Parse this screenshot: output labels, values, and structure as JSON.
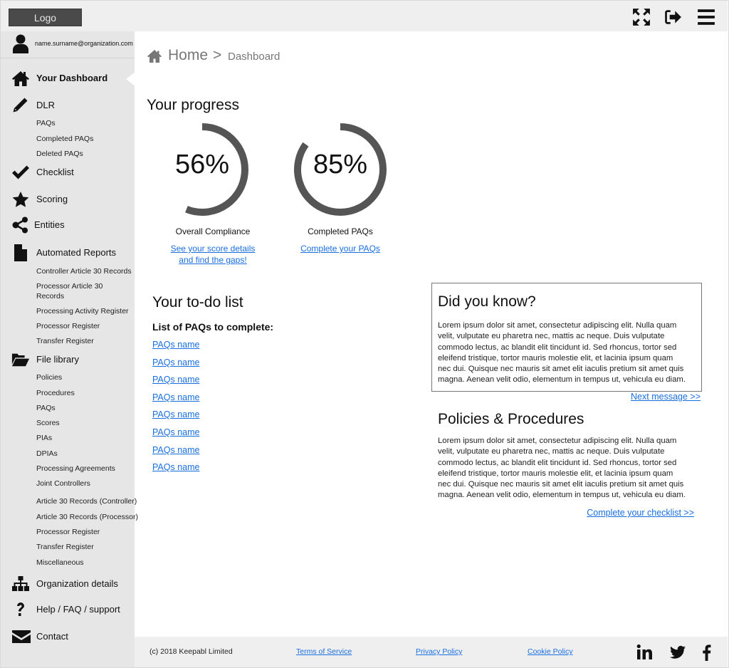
{
  "header": {
    "logo_label": "Logo",
    "icons": [
      "fullscreen-icon",
      "logout-icon",
      "menu-icon"
    ]
  },
  "user": {
    "email": "name.surname@organization.com",
    "icon": "user-icon"
  },
  "sidebar": {
    "items": [
      {
        "label": "Your Dashboard",
        "icon": "home-icon",
        "active": true,
        "children": []
      },
      {
        "label": "DLR",
        "icon": "pencil-icon",
        "children": [
          "PAQs",
          "Completed PAQs",
          "Deleted PAQs"
        ]
      },
      {
        "label": "Checklist",
        "icon": "check-icon",
        "children": []
      },
      {
        "label": "Scoring",
        "icon": "star-icon",
        "children": []
      },
      {
        "label": "Entities",
        "icon": "share-icon",
        "children": []
      },
      {
        "label": "Automated Reports",
        "icon": "file-icon",
        "children": [
          "Controller Article 30 Records",
          "Processor Article 30 Records",
          "Processing Activity Register",
          "Processor Register",
          "Transfer Register"
        ]
      },
      {
        "label": "File library",
        "icon": "folder-open-icon",
        "children": [
          "Policies",
          "Procedures",
          "PAQs",
          "Scores",
          "PIAs",
          "DPIAs",
          "Processing Agreements",
          "Joint Controllers",
          "Article 30 Records (Controller)",
          "Article 30 Records (Processor)",
          "Processor Register",
          "Transfer Register",
          "Miscellaneous"
        ]
      },
      {
        "label": "Organization details",
        "icon": "sitemap-icon",
        "children": []
      },
      {
        "label": "Help / FAQ / support",
        "icon": "question-icon",
        "children": []
      },
      {
        "label": "Contact",
        "icon": "envelope-icon",
        "children": []
      }
    ]
  },
  "breadcrumb": {
    "home": "Home",
    "separator": ">",
    "current": "Dashboard"
  },
  "progress": {
    "title": "Your progress",
    "rings": [
      {
        "value_text": "56%",
        "fraction": 0.56,
        "label": "Overall Compliance",
        "link_line1": "See your score details",
        "link_line2": "and find the gaps!"
      },
      {
        "value_text": "85%",
        "fraction": 0.85,
        "label": "Completed PAQs",
        "link_line1": "Complete your PAQs",
        "link_line2": ""
      }
    ],
    "ring_color": "#555555"
  },
  "todo": {
    "title": "Your to-do list",
    "subtitle": "List of PAQs to complete:",
    "items": [
      "PAQs name",
      "PAQs name",
      "PAQs name",
      "PAQs name",
      "PAQs name",
      "PAQs name",
      "PAQs name",
      "PAQs name"
    ]
  },
  "did_you_know": {
    "title": "Did you know?",
    "lines": [
      "Lorem ipsum dolor sit amet, consectetur adipiscing elit. Nulla quam",
      "velit, vulputate eu pharetra nec, mattis ac neque. Duis vulputate",
      "commodo lectus, ac blandit elit tincidunt id. Sed rhoncus, tortor sed",
      "eleifend tristique, tortor mauris molestie elit, et lacinia ipsum quam",
      "nec dui. Quisque nec mauris sit amet elit iaculis pretium sit amet quis",
      "magna. Aenean velit odio, elementum in tempus ut, vehicula eu diam."
    ],
    "next_link": "Next message >>"
  },
  "policies": {
    "title": "Policies & Procedures",
    "lines": [
      "Lorem ipsum dolor sit amet, consectetur adipiscing elit. Nulla quam",
      "velit, vulputate eu pharetra nec, mattis ac neque. Duis vulputate",
      "commodo lectus, ac blandit elit tincidunt id. Sed rhoncus, tortor sed",
      "eleifend tristique, tortor mauris molestie elit, et lacinia ipsum quam",
      "nec dui. Quisque nec mauris sit amet elit iaculis pretium sit amet quis",
      "magna. Aenean velit odio, elementum in tempus ut, vehicula eu diam."
    ],
    "link": "Complete your checklist >>"
  },
  "footer": {
    "copyright": "(c) 2018 Keepabl Limited",
    "links": [
      "Terms of Service",
      "Privacy Policy",
      "Cookie Policy"
    ],
    "social": [
      "linkedin-icon",
      "twitter-icon",
      "facebook-icon"
    ]
  },
  "colors": {
    "link": "#1a6fe0",
    "sidebar_bg": "#e6e6e6",
    "topbar_bg": "#efefef",
    "logo_bg": "#4a4a4a"
  }
}
